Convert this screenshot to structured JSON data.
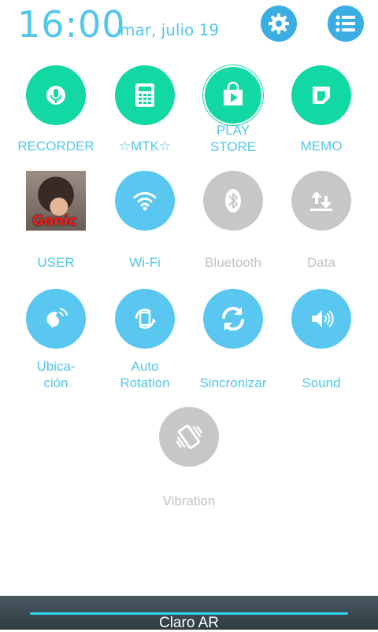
{
  "header": {
    "time": "16:00",
    "date": "mar, julio 19"
  },
  "tiles": [
    {
      "label": "RECORDER",
      "icon": "microphone-icon"
    },
    {
      "label": "☆MTK☆",
      "icon": "calculator-icon"
    },
    {
      "label": "PLAY\nSTORE",
      "icon": "play-store-icon"
    },
    {
      "label": "MEMO",
      "icon": "memo-icon"
    },
    {
      "label": "USER",
      "photo_text": "Gonic",
      "icon": "user-avatar"
    },
    {
      "label": "Wi-Fi",
      "icon": "wifi-icon"
    },
    {
      "label": "Bluetooth",
      "icon": "bluetooth-icon"
    },
    {
      "label": "Data",
      "icon": "data-transfer-icon"
    },
    {
      "label": "Ubica-\nción",
      "icon": "location-icon"
    },
    {
      "label": "Auto\nRotation",
      "icon": "auto-rotation-icon"
    },
    {
      "label": "Sincronizar",
      "icon": "sync-icon"
    },
    {
      "label": "Sound",
      "icon": "sound-icon"
    },
    {
      "label": "Vibration",
      "icon": "vibration-icon"
    }
  ],
  "status_bar": {
    "carrier": "Claro AR"
  },
  "colors": {
    "accent": "#53c6ec",
    "green": "#12d8a4",
    "off": "#c7c7c7"
  }
}
